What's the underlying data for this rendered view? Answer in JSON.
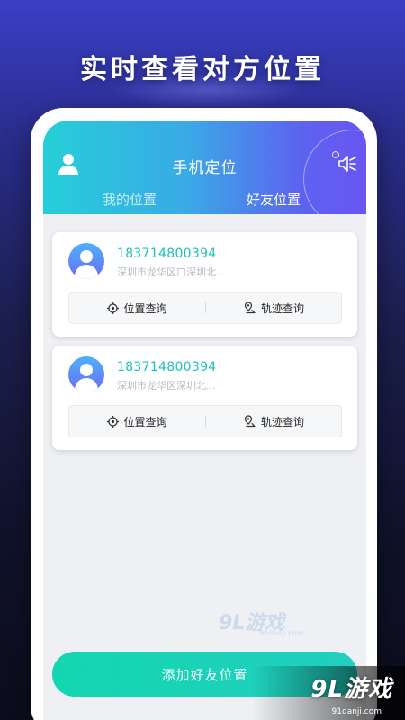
{
  "promo": {
    "title": "实时查看对方位置"
  },
  "app": {
    "title": "手机定位",
    "tabs": [
      {
        "label": "我的位置",
        "active": false
      },
      {
        "label": "好友位置",
        "active": true
      }
    ]
  },
  "friends": [
    {
      "phone": "183714800394",
      "address": "深圳市龙华区口深圳北...",
      "actions": {
        "locate": "位置查询",
        "track": "轨迹查询"
      }
    },
    {
      "phone": "183714800394",
      "address": "深圳市龙华区深圳北...",
      "actions": {
        "locate": "位置查询",
        "track": "轨迹查询"
      }
    }
  ],
  "add_button": {
    "label": "添加好友位置"
  },
  "watermark": {
    "text": "9L游戏",
    "sub": "91danji.com"
  },
  "brand": {
    "text": "9L游戏",
    "sub": "91danji.com"
  },
  "colors": {
    "accent_teal": "#1ec2b5",
    "header_start": "#25cfd8",
    "header_end": "#6a55f2",
    "button": "#13d6b0"
  },
  "icons": [
    "user-icon",
    "speaker-icon",
    "target-icon",
    "track-pin-icon",
    "avatar-icon"
  ]
}
